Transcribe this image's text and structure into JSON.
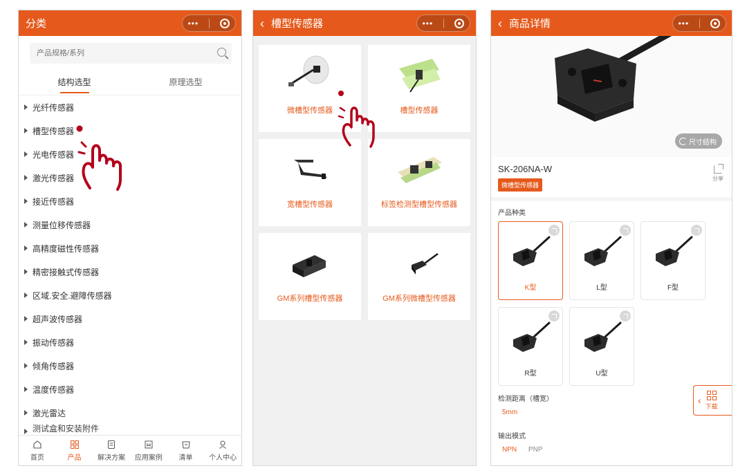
{
  "colors": {
    "accent": "#e55a1c",
    "hand": "#b3001b"
  },
  "left": {
    "title": "分类",
    "search_placeholder": "产品规格/系列",
    "tabs": [
      {
        "label": "结构选型"
      },
      {
        "label": "原理选型"
      }
    ],
    "categories": [
      {
        "label": "光纤传感器"
      },
      {
        "label": "槽型传感器"
      },
      {
        "label": "光电传感器"
      },
      {
        "label": "激光传感器"
      },
      {
        "label": "接近传感器"
      },
      {
        "label": "测量位移传感器"
      },
      {
        "label": "高精度磁性传感器"
      },
      {
        "label": "精密接触式传感器"
      },
      {
        "label": "区域.安全.避障传感器"
      },
      {
        "label": "超声波传感器"
      },
      {
        "label": "振动传感器"
      },
      {
        "label": "倾角传感器"
      },
      {
        "label": "温度传感器"
      },
      {
        "label": "激光雷达"
      },
      {
        "label": "测试盒和安装附件"
      }
    ],
    "tabbar": [
      {
        "label": "首页",
        "icon": "home-icon"
      },
      {
        "label": "产品",
        "icon": "grid-icon"
      },
      {
        "label": "解决方案",
        "icon": "document-icon"
      },
      {
        "label": "应用案例",
        "icon": "case-icon"
      },
      {
        "label": "清单",
        "icon": "list-icon"
      },
      {
        "label": "个人中心",
        "icon": "user-icon"
      }
    ],
    "active_tab_index": 1
  },
  "middle": {
    "title": "槽型传感器",
    "products": [
      {
        "label": "微槽型传感器",
        "icon": "micro-slot-sensor-image"
      },
      {
        "label": "槽型传感器",
        "icon": "slot-sensor-image"
      },
      {
        "label": "宽槽型传感器",
        "icon": "wide-slot-sensor-image"
      },
      {
        "label": "标签检测型槽型传感器",
        "icon": "label-detection-sensor-image"
      },
      {
        "label": "GM系列槽型传感器",
        "icon": "gm-slot-sensor-image"
      },
      {
        "label": "GM系列微槽型传感器",
        "icon": "gm-micro-slot-sensor-image"
      }
    ]
  },
  "right": {
    "title": "商品详情",
    "size_button": "尺寸结构",
    "model": "SK-206NA-W",
    "category_badge": "微槽型传感器",
    "share_label": "分享",
    "product_types_title": "产品种类",
    "types": [
      {
        "label": "K型",
        "selected": true
      },
      {
        "label": "L型",
        "selected": false
      },
      {
        "label": "F型",
        "selected": false
      },
      {
        "label": "R型",
        "selected": false
      },
      {
        "label": "U型",
        "selected": false
      }
    ],
    "detection_distance_label": "检测距离（槽宽）",
    "detection_distance_value": "5mm",
    "output_mode_label": "输出模式",
    "output_modes": [
      {
        "label": "NPN",
        "selected": true
      },
      {
        "label": "PNP",
        "selected": false
      }
    ],
    "download_label": "下载"
  }
}
